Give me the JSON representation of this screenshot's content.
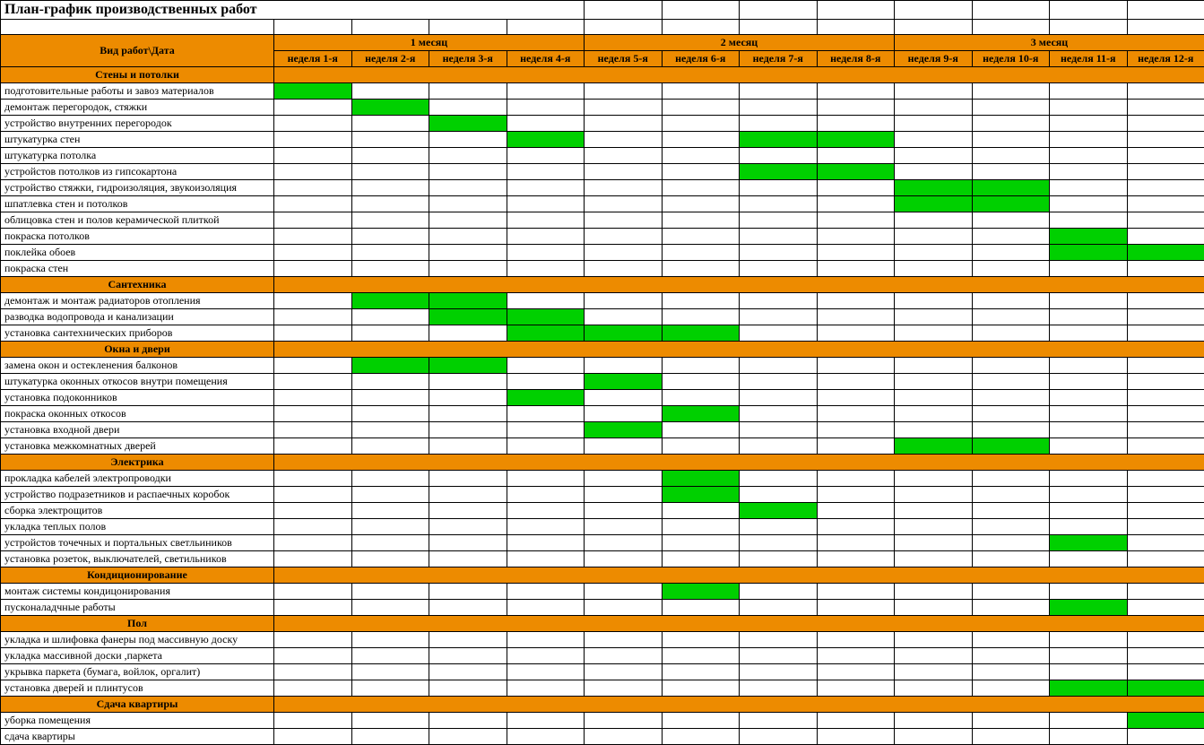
{
  "title": "План-график производственных работ",
  "header": {
    "task_col": "Вид работ\\Дата",
    "months": [
      "1 месяц",
      "2 месяц",
      "3 месяц"
    ],
    "weeks": [
      "неделя 1-я",
      "неделя 2-я",
      "неделя 3-я",
      "неделя 4-я",
      "неделя 5-я",
      "неделя 6-я",
      "неделя 7-я",
      "неделя 8-я",
      "неделя 9-я",
      "неделя 10-я",
      "неделя 11-я",
      "неделя 12-я"
    ]
  },
  "sections": [
    {
      "name": "Стены и потолки",
      "rows": [
        {
          "label": "подготовительные работы и завоз материалов",
          "weeks": [
            1
          ]
        },
        {
          "label": "демонтаж перегородок, стяжки",
          "weeks": [
            2
          ]
        },
        {
          "label": "устройство внутренних перегородок",
          "weeks": [
            3
          ]
        },
        {
          "label": "штукатурка стен",
          "weeks": [
            4,
            7,
            8
          ]
        },
        {
          "label": "штукатурка потолка",
          "weeks": []
        },
        {
          "label": "устройстов потолков из гипсокартона",
          "weeks": [
            7,
            8
          ]
        },
        {
          "label": "устройство стяжки, гидроизоляция, звукоизоляция",
          "weeks": [
            9,
            10
          ]
        },
        {
          "label": "шпатлевка стен и потолков",
          "weeks": [
            9,
            10
          ]
        },
        {
          "label": "облицовка стен и полов керамической плиткой",
          "weeks": []
        },
        {
          "label": "покраска потолков",
          "weeks": [
            11
          ]
        },
        {
          "label": "поклейка обоев",
          "weeks": [
            11,
            12
          ]
        },
        {
          "label": "покраска стен",
          "weeks": []
        }
      ]
    },
    {
      "name": "Сантехника",
      "rows": [
        {
          "label": "демонтаж и монтаж радиаторов отопления",
          "weeks": [
            2,
            3
          ]
        },
        {
          "label": "разводка водопровода и канализации",
          "weeks": [
            3,
            4
          ]
        },
        {
          "label": "установка сантехнических приборов",
          "weeks": [
            4,
            5,
            6
          ]
        }
      ]
    },
    {
      "name": "Окна и двери",
      "rows": [
        {
          "label": "замена окон и остекленения балконов",
          "weeks": [
            2,
            3
          ]
        },
        {
          "label": "штукатурка оконных откосов внутри помещения",
          "weeks": [
            5
          ]
        },
        {
          "label": "установка подоконников",
          "weeks": [
            4
          ]
        },
        {
          "label": "покраска оконных откосов",
          "weeks": [
            6
          ]
        },
        {
          "label": "установка входной двери",
          "weeks": [
            5
          ]
        },
        {
          "label": "установка межкомнатных дверей",
          "weeks": [
            9,
            10
          ]
        }
      ]
    },
    {
      "name": "Электрика",
      "rows": [
        {
          "label": "прокладка кабелей электропроводки",
          "weeks": [
            6
          ]
        },
        {
          "label": "устройство подразетников и распаечных коробок",
          "weeks": [
            6
          ]
        },
        {
          "label": "сборка электрощитов",
          "weeks": [
            7
          ]
        },
        {
          "label": "укладка теплых полов",
          "weeks": []
        },
        {
          "label": "устройстов точечных и портальных светльиников",
          "weeks": [
            11
          ]
        },
        {
          "label": "установка розеток, выключателей, светильников",
          "weeks": []
        }
      ]
    },
    {
      "name": "Кондиционирование",
      "rows": [
        {
          "label": "монтаж системы кондицонирования",
          "weeks": [
            6
          ]
        },
        {
          "label": "пусконаладчные работы",
          "weeks": [
            11
          ]
        }
      ]
    },
    {
      "name": "Пол",
      "rows": [
        {
          "label": "укладка и шлифовка фанеры под массивную доску",
          "weeks": []
        },
        {
          "label": "укладка массивной доски ,паркета",
          "weeks": []
        },
        {
          "label": "укрывка паркета (бумага, войлок, оргалит)",
          "weeks": []
        },
        {
          "label": "установка дверей и плинтусов",
          "weeks": [
            11,
            12
          ]
        }
      ]
    },
    {
      "name": "Сдача квартиры",
      "rows": [
        {
          "label": "уборка помещения",
          "weeks": [
            12
          ]
        },
        {
          "label": "сдача квартиры",
          "weeks": []
        }
      ]
    }
  ],
  "chart_data": {
    "type": "table",
    "title": "План-график производственных работ",
    "columns": [
      "неделя 1-я",
      "неделя 2-я",
      "неделя 3-я",
      "неделя 4-я",
      "неделя 5-я",
      "неделя 6-я",
      "неделя 7-я",
      "неделя 8-я",
      "неделя 9-я",
      "неделя 10-я",
      "неделя 11-я",
      "неделя 12-я"
    ],
    "note": "Gantt-style: green cell = task scheduled in that week. See sections[].rows[].weeks for data."
  }
}
